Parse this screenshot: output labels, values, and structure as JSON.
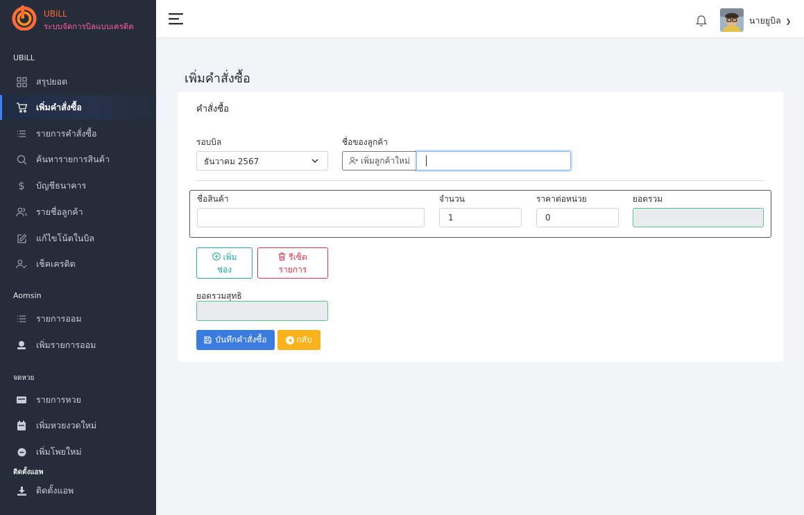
{
  "brand": {
    "name": "UBiLL",
    "subtitle": "ระบบจัดการบิลแบบเครดิต"
  },
  "sidebar": {
    "sections": [
      "UBiLL",
      "Aomsin",
      "จดหวย",
      "ติดตั้งแอพ"
    ],
    "items": [
      {
        "label": "สรุปยอด",
        "icon": "grid-icon"
      },
      {
        "label": "เพิ่มคำสั่งซื้อ",
        "icon": "cart-icon",
        "active": true
      },
      {
        "label": "รายการคำสั่งซื้อ",
        "icon": "list-icon"
      },
      {
        "label": "ค้นหารายการสินค้า",
        "icon": "search-icon"
      },
      {
        "label": "บัญชีธนาคาร",
        "icon": "dollar-icon"
      },
      {
        "label": "รายชื่อลูกค้า",
        "icon": "users-icon"
      },
      {
        "label": "แก้ไขโน้ตในบิล",
        "icon": "edit-icon"
      },
      {
        "label": "เช็คเครดิต",
        "icon": "user-check-icon"
      },
      {
        "label": "รายการออม",
        "icon": "list-icon"
      },
      {
        "label": "เพิ่มรายการออม",
        "icon": "piggy-icon"
      },
      {
        "label": "รายการหวย",
        "icon": "ticket-icon"
      },
      {
        "label": "เพิ่มหวยงวดใหม่",
        "icon": "calendar-icon"
      },
      {
        "label": "เพิ่มโพยใหม่",
        "icon": "minus-circle-icon"
      },
      {
        "label": "ติดตั้งแอพ",
        "icon": "download-icon"
      }
    ]
  },
  "header": {
    "username": "นายยูบิล"
  },
  "page": {
    "title": "เพิ่มคำสั่งซื้อ"
  },
  "form": {
    "card_title": "คำสั่งซื้อ",
    "bill_round_label": "รอบบิล",
    "bill_round_value": "ธันวาคม 2567",
    "customer_label": "ชื่อของลูกค้า",
    "add_customer_button": "เพิ่มลูกค้าใหม่",
    "customer_value": "",
    "item": {
      "name_label": "ชื่อสินค้า",
      "qty_label": "จำนวน",
      "unit_price_label": "ราคาต่อหน่วย",
      "total_label": "ยอดรวม",
      "name_value": "",
      "qty_value": "1",
      "unit_price_value": "0",
      "total_value": ""
    },
    "add_row_button_line1": "เพิ่ม",
    "add_row_button_line2": "ช่อง",
    "reset_button_line1": "รีเซ็ต",
    "reset_button_line2": "รายการ",
    "net_total_label": "ยอดรวมสุทธิ",
    "net_total_value": "",
    "save_button": "บันทึกคำสั่งซื้อ",
    "back_button": "กลับ"
  },
  "colors": {
    "sidebar_bg": "#252d3a",
    "brand_orange": "#ff6b35",
    "primary": "#3a7be0",
    "warning": "#f8b21c",
    "danger": "#dc3545",
    "teal": "#20a8a0"
  }
}
